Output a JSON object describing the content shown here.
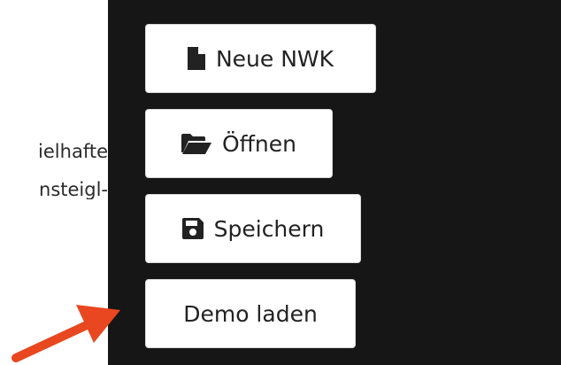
{
  "left_text": {
    "line1": "ielhafte",
    "line2": "nsteigl-"
  },
  "toolbar": {
    "new_label": "Neue NWK",
    "new_icon": "file-icon",
    "open_label": "Öffnen",
    "open_icon": "folder-open-icon",
    "save_label": "Speichern",
    "save_icon": "floppy-disk-icon",
    "demo_label": "Demo laden"
  },
  "colors": {
    "panel_background": "#161616",
    "button_background": "#ffffff",
    "annotation_arrow": "#e8471f"
  }
}
